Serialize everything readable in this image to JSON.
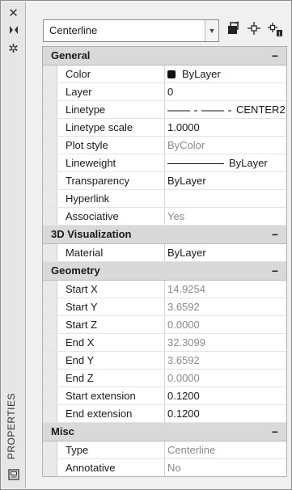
{
  "side_strip": {
    "close_icon": "close-icon",
    "autohide_icon": "autohide-icon",
    "settings_icon": "settings-icon",
    "title": "PROPERTIES",
    "bottom_icon": "palette-icon"
  },
  "selector": {
    "value": "Centerline",
    "quick_select_icon": "quick-select-icon",
    "select_objects_icon": "select-objects-icon",
    "pickadd_icon": "pickadd-icon"
  },
  "sections": [
    {
      "title": "General",
      "collapse": "−",
      "rows": [
        {
          "name": "Color",
          "value": "ByLayer",
          "kind": "color",
          "readonly": false
        },
        {
          "name": "Layer",
          "value": "0",
          "kind": "text",
          "readonly": false
        },
        {
          "name": "Linetype",
          "value": "CENTER2",
          "kind": "linetype",
          "readonly": false
        },
        {
          "name": "Linetype scale",
          "value": "1.0000",
          "kind": "text",
          "readonly": false
        },
        {
          "name": "Plot style",
          "value": "ByColor",
          "kind": "text",
          "readonly": true
        },
        {
          "name": "Lineweight",
          "value": "ByLayer",
          "kind": "lineweight",
          "readonly": false
        },
        {
          "name": "Transparency",
          "value": "ByLayer",
          "kind": "text",
          "readonly": false
        },
        {
          "name": "Hyperlink",
          "value": "",
          "kind": "text",
          "readonly": false
        },
        {
          "name": "Associative",
          "value": "Yes",
          "kind": "text",
          "readonly": true
        }
      ]
    },
    {
      "title": "3D Visualization",
      "collapse": "−",
      "rows": [
        {
          "name": "Material",
          "value": "ByLayer",
          "kind": "text",
          "readonly": false
        }
      ]
    },
    {
      "title": "Geometry",
      "collapse": "−",
      "rows": [
        {
          "name": "Start X",
          "value": "14.9254",
          "kind": "text",
          "readonly": true
        },
        {
          "name": "Start Y",
          "value": "3.6592",
          "kind": "text",
          "readonly": true
        },
        {
          "name": "Start Z",
          "value": "0.0000",
          "kind": "text",
          "readonly": true
        },
        {
          "name": "End X",
          "value": "32.3099",
          "kind": "text",
          "readonly": true
        },
        {
          "name": "End Y",
          "value": "3.6592",
          "kind": "text",
          "readonly": true
        },
        {
          "name": "End Z",
          "value": "0.0000",
          "kind": "text",
          "readonly": true
        },
        {
          "name": "Start extension",
          "value": "0.1200",
          "kind": "text",
          "readonly": false
        },
        {
          "name": "End extension",
          "value": "0.1200",
          "kind": "text",
          "readonly": false
        }
      ]
    },
    {
      "title": "Misc",
      "collapse": "−",
      "rows": [
        {
          "name": "Type",
          "value": "Centerline",
          "kind": "text",
          "readonly": true
        },
        {
          "name": "Annotative",
          "value": "No",
          "kind": "text",
          "readonly": true
        }
      ]
    }
  ]
}
